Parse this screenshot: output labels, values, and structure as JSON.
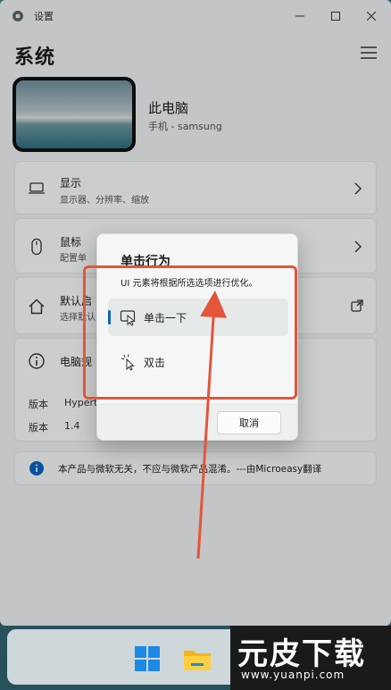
{
  "window": {
    "title": "设置",
    "page_title": "系统"
  },
  "device": {
    "name": "此电脑",
    "subtitle": "手机 - samsung"
  },
  "settings": {
    "display": {
      "label": "显示",
      "sub": "显示器、分辨率、缩放"
    },
    "mouse": {
      "label": "鼠标",
      "sub": "配置单"
    },
    "default_app": {
      "label": "默认启",
      "sub": "选择默认"
    },
    "about": {
      "label": "电脑规"
    }
  },
  "version_rows": [
    {
      "label": "版本",
      "value": "Hypert"
    },
    {
      "label": "版本",
      "value": "1.4"
    }
  ],
  "notice": {
    "text": "本产品与微软无关，不应与微软产品混淆。---由Microeasy翻译"
  },
  "dialog": {
    "title": "单击行为",
    "description": "UI 元素将根据所选选项进行优化。",
    "options": [
      {
        "label": "单击一下",
        "selected": true,
        "icon": "cursor-click-icon"
      },
      {
        "label": "双击",
        "selected": false,
        "icon": "double-click-icon"
      }
    ],
    "cancel_label": "取消"
  },
  "watermark": {
    "brand": "元皮下载",
    "url": "www.yuanpi.com"
  },
  "colors": {
    "accent": "#0a64c2",
    "annotation": "#e4553b",
    "watermark_green": "#8cc63f"
  }
}
